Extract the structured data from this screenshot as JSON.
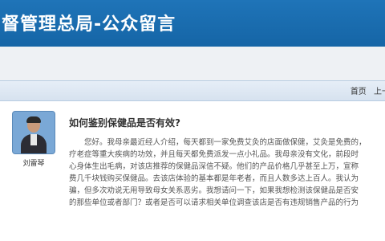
{
  "header": {
    "title": "督管理总局-公众留言"
  },
  "pager": {
    "first": "首页",
    "prev": "上一"
  },
  "user": {
    "name": "刘雷琴"
  },
  "post": {
    "title": "如何鉴别保健品是否有效?",
    "lines": [
      "您好。我母亲最近经人介绍，每天都到一家免费艾灸的店面做保健，艾灸是免费的，",
      "疗老症等重大疾病的功效，并且每天都免费派发一点小礼品。我母亲没有文化，前段时",
      "心身体生出毛病，对该店推荐的保健品深信不疑。他们的产品价格几乎甚至上万，宣称",
      "费几千块钱购买保健品。去该店体验的基本都是年老者，而且人数多达上百人。我认为",
      "骗，但多次劝说无用导致母女关系恶劣。我想请问一下，如果我想检测该保健品是否安",
      "的那些单位或者部门？或者是否可以请求相关单位调查该店是否有违规销售产品的行为"
    ]
  }
}
